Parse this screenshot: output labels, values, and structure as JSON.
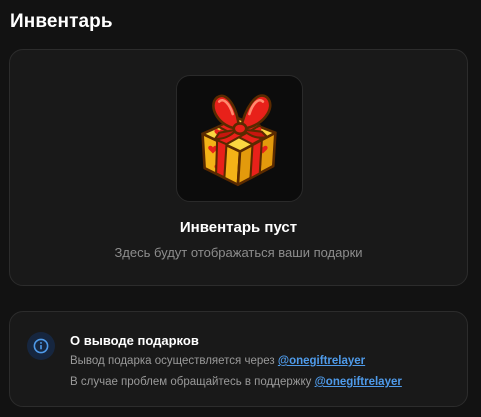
{
  "header": {
    "title": "Инвентарь"
  },
  "inventory": {
    "empty_title": "Инвентарь пуст",
    "empty_subtitle": "Здесь будут отображаться ваши подарки",
    "illustration": "gift-box-icon"
  },
  "withdraw_info": {
    "icon": "info-icon",
    "title": "О выводе подарков",
    "line1_text": "Вывод подарка осуществляется через",
    "line1_link": "@onegiftrelayer",
    "line2_text": "В случае проблем обращайтесь в поддержку",
    "line2_link": "@onegiftrelayer"
  },
  "colors": {
    "background": "#121212",
    "card": "#191919",
    "link": "#4f9bea",
    "muted_text": "#8d8d8d",
    "gift_red": "#e8211a",
    "gift_yellow": "#f7c21c"
  }
}
